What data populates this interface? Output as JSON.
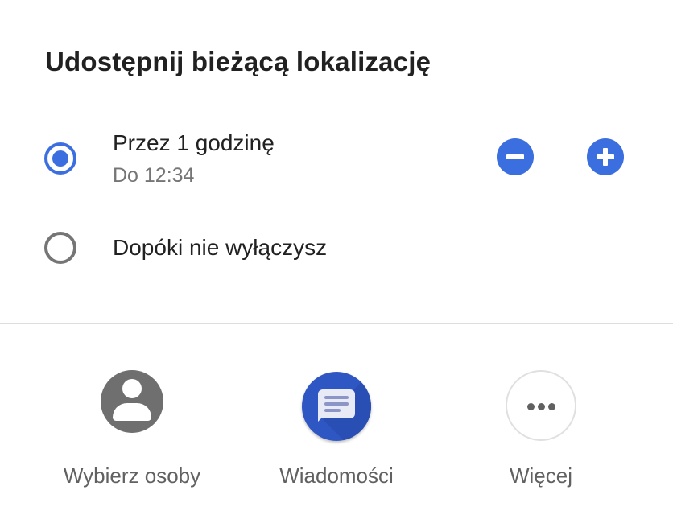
{
  "dialog": {
    "title": "Udostępnij bieżącą lokalizację"
  },
  "options": [
    {
      "label": "Przez 1 godzinę",
      "sublabel": "Do 12:34",
      "selected": true
    },
    {
      "label": "Dopóki nie wyłączysz",
      "selected": false
    }
  ],
  "duration_controls": {
    "decrease_icon": "minus-circle-icon",
    "increase_icon": "plus-circle-icon"
  },
  "share_targets": [
    {
      "label": "Wybierz osoby",
      "icon": "person-icon"
    },
    {
      "label": "Wiadomości",
      "icon": "messages-app-icon"
    },
    {
      "label": "Więcej",
      "icon": "more-horiz-icon"
    }
  ],
  "colors": {
    "accent": "#3b6fe0",
    "messages_brand": "#2f57c4",
    "text_primary": "#212121",
    "text_secondary": "#757575"
  }
}
